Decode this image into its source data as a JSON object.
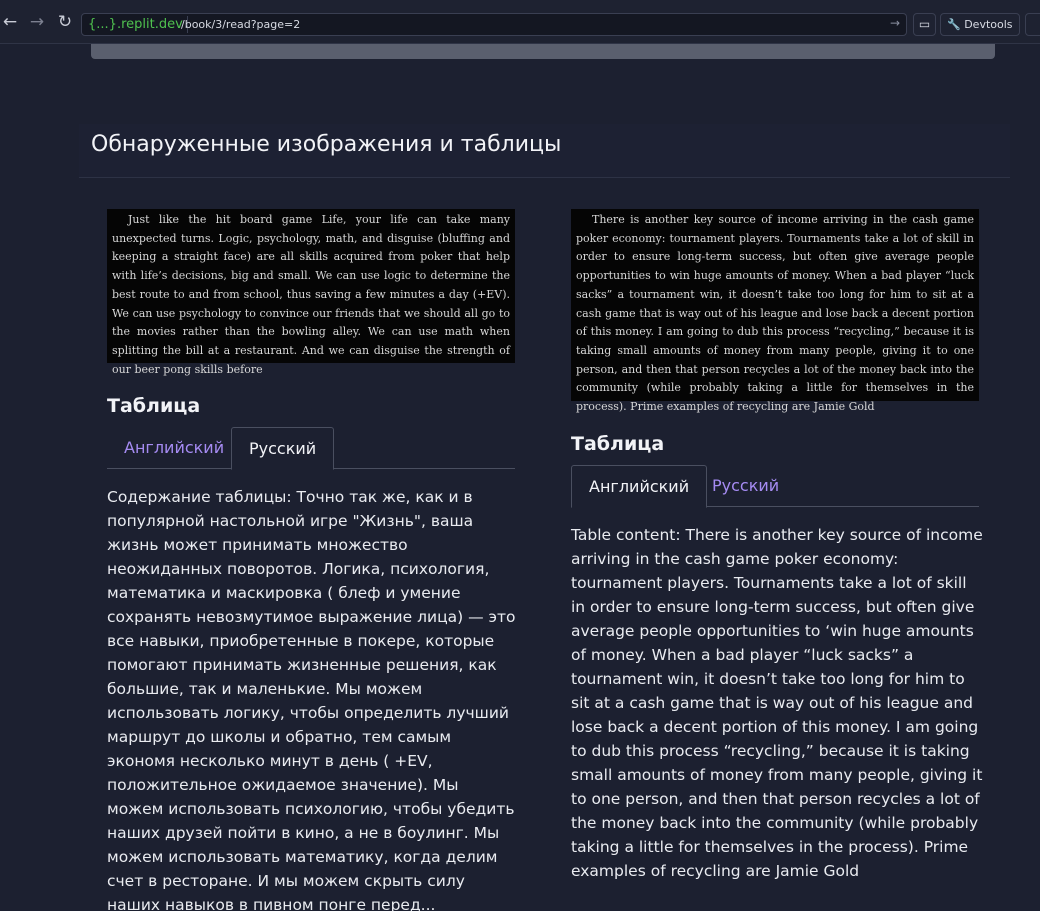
{
  "browser": {
    "url_host": "{...}.replit.dev",
    "url_path": "/book/3/read?page=2",
    "devtools_label": "Devtools"
  },
  "section": {
    "title": "Обнаруженные изображения и таблицы"
  },
  "items": [
    {
      "scan_text": "Just like the hit board game Life, your life can take many unexpected turns. Logic, psychology, math, and disguise (bluffing and keeping a straight face) are all skills acquired from poker that help with life’s decisions, big and small. We can use logic to determine the best route to and from school, thus saving a few minutes a day (+EV). We can use psychology to convince our friends that we should all go to the movies rather than the bowling alley. We can use math when splitting the bill at a restaurant. And we can disguise the strength of our beer pong skills before",
      "table_heading": "Таблица",
      "tab_english": "Английский",
      "tab_russian": "Русский",
      "active_tab": "russian",
      "content": "Содержание таблицы: Точно так же, как и в популярной настольной игре \"Жизнь\", ваша жизнь может принимать множество неожиданных поворотов. Логика, психология, математика и маскировка ( блеф и умение сохранять невозмутимое выражение лица) — это все навыки, приобретенные в покере, которые помогают принимать жизненные решения, как большие, так и маленькие. Мы можем использовать логику, чтобы определить лучший маршрут до школы и обратно, тем самым экономя несколько минут в день ( +EV, положительное ожидаемое значение). Мы можем использовать психологию, чтобы убедить наших друзей пойти в кино, а не в боулинг. Мы можем использовать математику, когда делим счет в ресторане. И мы можем скрыть силу наших навыков в пивном понге перед..."
    },
    {
      "scan_text": "There is another key source of income arriving in the cash game poker economy: tournament players. Tournaments take a lot of skill in order to ensure long-term success, but often give average people opportunities to win huge amounts of money. When a bad player “luck sacks” a tournament win, it doesn’t take too long for him to sit at a cash game that is way out of his league and lose back a decent portion of this money. I am going to dub this process “recycling,” because it is taking small amounts of money from many people, giving it to one person, and then that person recycles a lot of the money back into the community (while probably taking a little for themselves in the process). Prime examples of recycling are Jamie Gold",
      "table_heading": "Таблица",
      "tab_english": "Английский",
      "tab_russian": "Русский",
      "active_tab": "english",
      "content": "Table content: There is another key source of income arriving in the cash game poker economy: tournament players. Tournaments take a lot of skill in order to ensure long-term success, but often give average people opportunities to ‘win huge amounts of money. When a bad player “luck sacks” a tournament win, it doesn’t take too long for him to sit at a cash game that is way out of his league and lose back a decent portion of this money. I am going to dub this process “recycling,” because it is taking small amounts of money from many people, giving it to one person, and then that person recycles a lot of the money back into the community (while probably taking a little for themselves in the process). Prime examples of recycling are Jamie Gold"
    }
  ]
}
